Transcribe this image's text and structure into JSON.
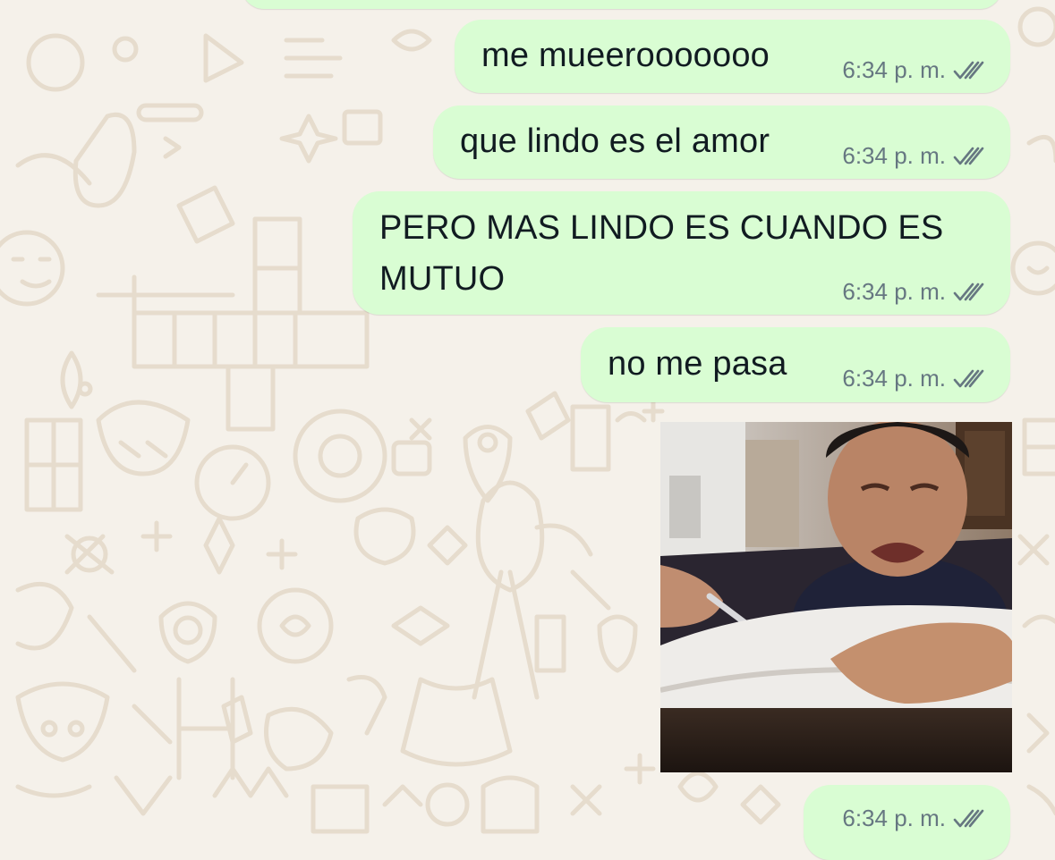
{
  "chat": {
    "messages": [
      {
        "type": "text",
        "text": "me mueerooooooo",
        "time": "6:34 p. m.",
        "status_icon": "double-check-read-icon"
      },
      {
        "type": "text",
        "text": "que lindo es el amor",
        "time": "6:34 p. m.",
        "status_icon": "double-check-read-icon"
      },
      {
        "type": "text",
        "text": "PERO MAS LINDO ES CUANDO ES\nMUTUO",
        "time": "6:34 p. m.",
        "status_icon": "double-check-read-icon"
      },
      {
        "type": "text",
        "text": "no me pasa",
        "time": "6:34 p. m.",
        "status_icon": "double-check-read-icon"
      },
      {
        "type": "image",
        "time": "6:34 p. m.",
        "status_icon": "double-check-read-icon"
      }
    ]
  },
  "colors": {
    "wallpaper": "#f5f1ea",
    "doodle": "#e8dfd2",
    "outgoing_bubble": "#d9fdd3",
    "meta_text": "#667781",
    "message_text": "#111b21"
  }
}
